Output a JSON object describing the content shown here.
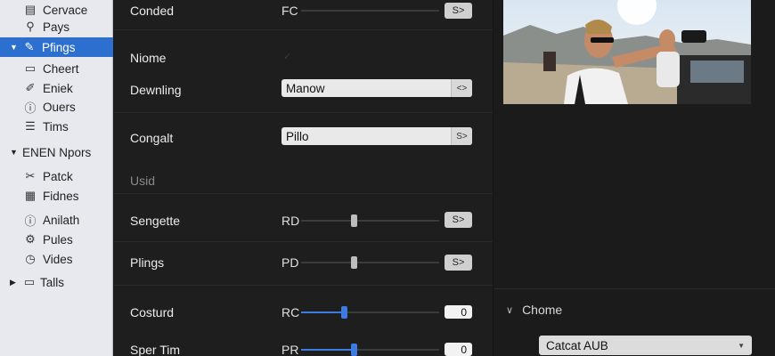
{
  "sidebar": {
    "items": [
      {
        "label": "Cervace",
        "icon": "document-icon"
      },
      {
        "label": "Pays",
        "icon": "search-icon"
      },
      {
        "label": "Pfings",
        "icon": "settings-icon"
      },
      {
        "label": "Cheert",
        "icon": "folder-icon"
      },
      {
        "label": "Eniek",
        "icon": "edit-icon"
      },
      {
        "label": "Ouers",
        "icon": "info-icon"
      },
      {
        "label": "Tims",
        "icon": "list-icon"
      }
    ],
    "section2": {
      "label": "ENEN Npors"
    },
    "items2": [
      {
        "label": "Patck",
        "icon": "patch-icon"
      },
      {
        "label": "Fidnes",
        "icon": "grid-icon"
      },
      {
        "label": "Anilath",
        "icon": "info-icon"
      },
      {
        "label": "Pules",
        "icon": "gear-icon"
      },
      {
        "label": "Vides",
        "icon": "clock-icon"
      }
    ],
    "section3": {
      "label": "Talls"
    }
  },
  "settings": {
    "conded": {
      "label": "Conded",
      "short": "FC",
      "stepper": "S>"
    },
    "niome": {
      "label": "Niome",
      "checked": true
    },
    "dewnling": {
      "label": "Dewnling",
      "value": "Manow",
      "arrow": "<>"
    },
    "congalt": {
      "label": "Congalt",
      "value": "Pillo",
      "arrow": "S>"
    },
    "usid": {
      "label": "Usid"
    },
    "sengette": {
      "label": "Sengette",
      "short": "RD",
      "stepper": "S>",
      "level": 0.38
    },
    "plings": {
      "label": "Plings",
      "short": "PD",
      "stepper": "S>",
      "level": 0.38
    },
    "costurd": {
      "label": "Costurd",
      "short": "RC",
      "value": "0",
      "level": 0.31
    },
    "sper_tim": {
      "label": "Sper Tim",
      "short": "PR",
      "value": "0",
      "level": 0.38
    }
  },
  "right": {
    "section": {
      "label": "Chome"
    },
    "popup": {
      "value": "Catcat AUB"
    }
  },
  "colors": {
    "accent": "#2c6fcf",
    "slider_blue": "#3d7be0"
  }
}
